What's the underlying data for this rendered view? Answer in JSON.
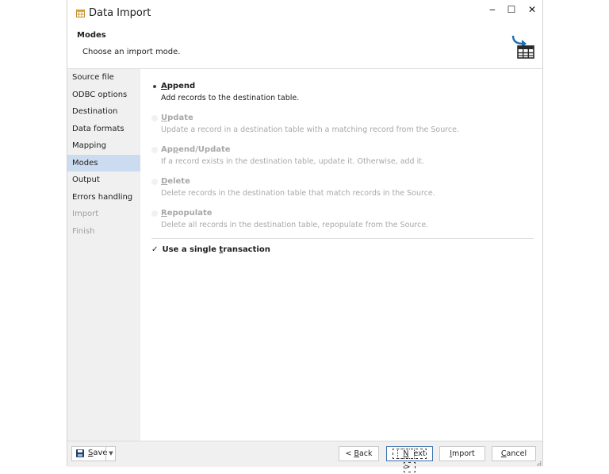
{
  "window": {
    "title": "Data Import",
    "controls": {
      "minimize": "‒",
      "maximize": "☐",
      "close": "✕"
    }
  },
  "header": {
    "title": "Modes",
    "subtitle": "Choose an import mode."
  },
  "sidebar": {
    "items": [
      {
        "label": "Source file",
        "state": "normal"
      },
      {
        "label": "ODBC options",
        "state": "normal"
      },
      {
        "label": "Destination",
        "state": "normal"
      },
      {
        "label": "Data formats",
        "state": "normal"
      },
      {
        "label": "Mapping",
        "state": "normal"
      },
      {
        "label": "Modes",
        "state": "active"
      },
      {
        "label": "Output",
        "state": "normal"
      },
      {
        "label": "Errors handling",
        "state": "normal"
      },
      {
        "label": "Import",
        "state": "disabled"
      },
      {
        "label": "Finish",
        "state": "disabled"
      }
    ]
  },
  "modes": [
    {
      "key_letter": "A",
      "label_rest": "ppend",
      "description": "Add records to the destination table.",
      "selected": true,
      "enabled": true
    },
    {
      "key_letter": "U",
      "label_rest": "pdate",
      "description": "Update a record in a destination table with a matching record from the Source.",
      "selected": false,
      "enabled": false
    },
    {
      "label_pre": "Ap",
      "key_letter": "p",
      "label_rest": "end/Update",
      "description": "If a record exists in the destination table, update it. Otherwise, add it.",
      "selected": false,
      "enabled": false
    },
    {
      "key_letter": "D",
      "label_rest": "elete",
      "description": "Delete records in the destination table that match records in the Source.",
      "selected": false,
      "enabled": false
    },
    {
      "key_letter": "R",
      "label_rest": "epopulate",
      "description": "Delete all records in the destination table, repopulate from the Source.",
      "selected": false,
      "enabled": false
    }
  ],
  "transaction": {
    "checked": true,
    "check_mark": "✓",
    "label_pre": "Use a single ",
    "key_letter": "t",
    "label_rest": "ransaction"
  },
  "footer": {
    "save": {
      "key_letter": "S",
      "label_rest": "ave",
      "dropdown_glyph": "▼"
    },
    "back": {
      "pre": "< ",
      "key_letter": "B",
      "rest": "ack"
    },
    "next": {
      "key_letter": "N",
      "rest": "ext >"
    },
    "import": {
      "key_letter": "I",
      "rest": "mport"
    },
    "cancel": {
      "key_letter": "C",
      "rest": "ancel"
    }
  },
  "colors": {
    "sidebar_bg": "#f0f0f0",
    "sidebar_active": "#ccdcf0",
    "accent_blue": "#1f6fb5",
    "disabled_text": "#a8a8a8"
  }
}
